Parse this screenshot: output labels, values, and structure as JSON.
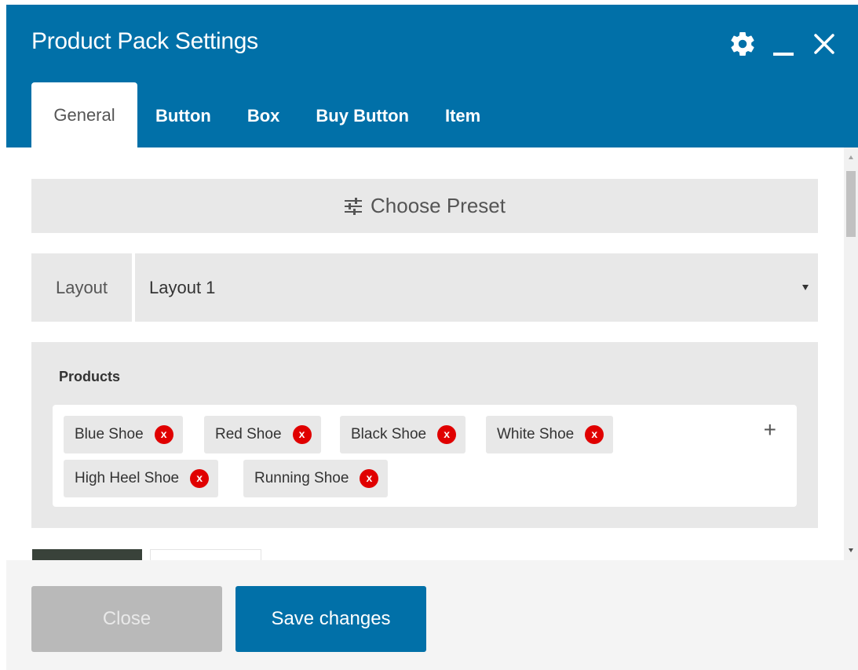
{
  "window": {
    "title": "Product Pack Settings"
  },
  "header_icons": [
    {
      "name": "gear-icon"
    },
    {
      "name": "minimize-icon"
    },
    {
      "name": "close-icon"
    }
  ],
  "tabs": [
    {
      "label": "General",
      "active": true
    },
    {
      "label": "Button",
      "active": false
    },
    {
      "label": "Box",
      "active": false
    },
    {
      "label": "Buy Button",
      "active": false
    },
    {
      "label": "Item",
      "active": false
    }
  ],
  "preset": {
    "label": "Choose Preset",
    "icon": "sliders-icon"
  },
  "layout": {
    "label": "Layout",
    "selected": "Layout 1"
  },
  "products": {
    "label": "Products",
    "remove_glyph": "x",
    "add_glyph": "+",
    "items": [
      "Blue Shoe",
      "Red Shoe",
      "Black Shoe",
      "White Shoe",
      "High Heel Shoe",
      "Running Shoe"
    ]
  },
  "footer": {
    "close_label": "Close",
    "save_label": "Save changes"
  },
  "colors": {
    "primary": "#0170a8",
    "remove_chip": "#e00000",
    "panel": "#e8e8e8"
  }
}
